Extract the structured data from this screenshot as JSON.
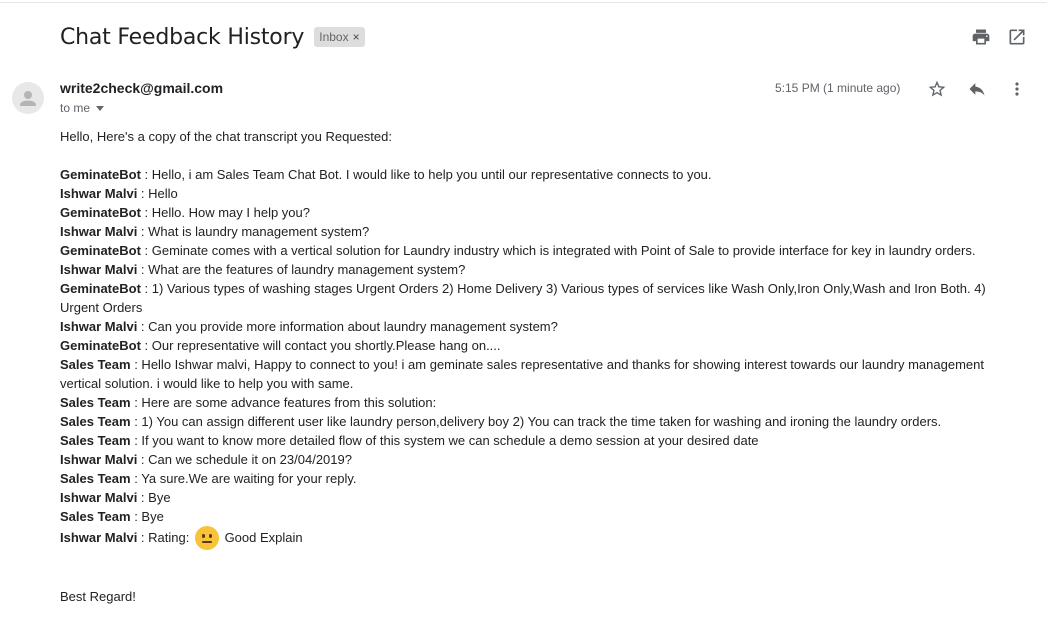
{
  "email": {
    "subject": "Chat Feedback History",
    "label": "Inbox",
    "label_remove": "×",
    "sender": "write2check@gmail.com",
    "recipient": "to me",
    "time": "5:15 PM (1 minute ago)",
    "intro": "Hello, Here's a copy of the chat transcript you Requested:",
    "messages": [
      {
        "who": "GeminateBot",
        "text": " : Hello, i am Sales Team Chat Bot. I would like to help you until our representative connects to you."
      },
      {
        "who": "Ishwar Malvi",
        "text": " : Hello"
      },
      {
        "who": "GeminateBot",
        "text": " : Hello. How may I help you?"
      },
      {
        "who": "Ishwar Malvi",
        "text": " : What is laundry management system?"
      },
      {
        "who": "GeminateBot",
        "text": " : Geminate comes with a vertical solution for Laundry industry which is integrated with Point of Sale to provide interface for key in laundry orders."
      },
      {
        "who": "Ishwar Malvi",
        "text": " : What are the features of laundry management system?"
      },
      {
        "who": "GeminateBot",
        "text": " : 1) Various types of washing stages Urgent Orders 2) Home Delivery 3) Various types of services like Wash Only,Iron Only,Wash and Iron Both. 4) Urgent Orders"
      },
      {
        "who": "Ishwar Malvi",
        "text": " : Can you provide more information about laundry management system?"
      },
      {
        "who": "GeminateBot",
        "text": " : Our representative will contact you shortly.Please hang on...."
      },
      {
        "who": "Sales Team",
        "text": " : Hello Ishwar malvi, Happy to connect to you! i am geminate sales representative and thanks for showing interest towards our laundry management vertical solution. i would like to help you with same."
      },
      {
        "who": "Sales Team",
        "text": " : Here are some advance features from this solution:"
      },
      {
        "who": "Sales Team",
        "text": " : 1) You can assign different user like laundry person,delivery boy 2) You can track the time taken for washing and ironing the laundry orders."
      },
      {
        "who": "Sales Team",
        "text": " : If you want to know more detailed flow of this system we can schedule a demo session at your desired date"
      },
      {
        "who": "Ishwar Malvi",
        "text": " : Can we schedule it on 23/04/2019?"
      },
      {
        "who": "Sales Team",
        "text": " : Ya sure.We are waiting for your reply."
      },
      {
        "who": "Ishwar Malvi",
        "text": " : Bye"
      },
      {
        "who": "Sales Team",
        "text": " : Bye"
      }
    ],
    "rating": {
      "who": "Ishwar Malvi",
      "prefix": " : Rating: ",
      "emoji": "neutral-face-emoji",
      "suffix": " Good Explain"
    },
    "closing": "Best Regard!"
  },
  "icons": {
    "print": "print-icon",
    "open_new": "open-in-new-window-icon",
    "star": "star-icon",
    "reply": "reply-icon",
    "more": "more-vertical-icon",
    "avatar": "default-avatar-icon"
  }
}
